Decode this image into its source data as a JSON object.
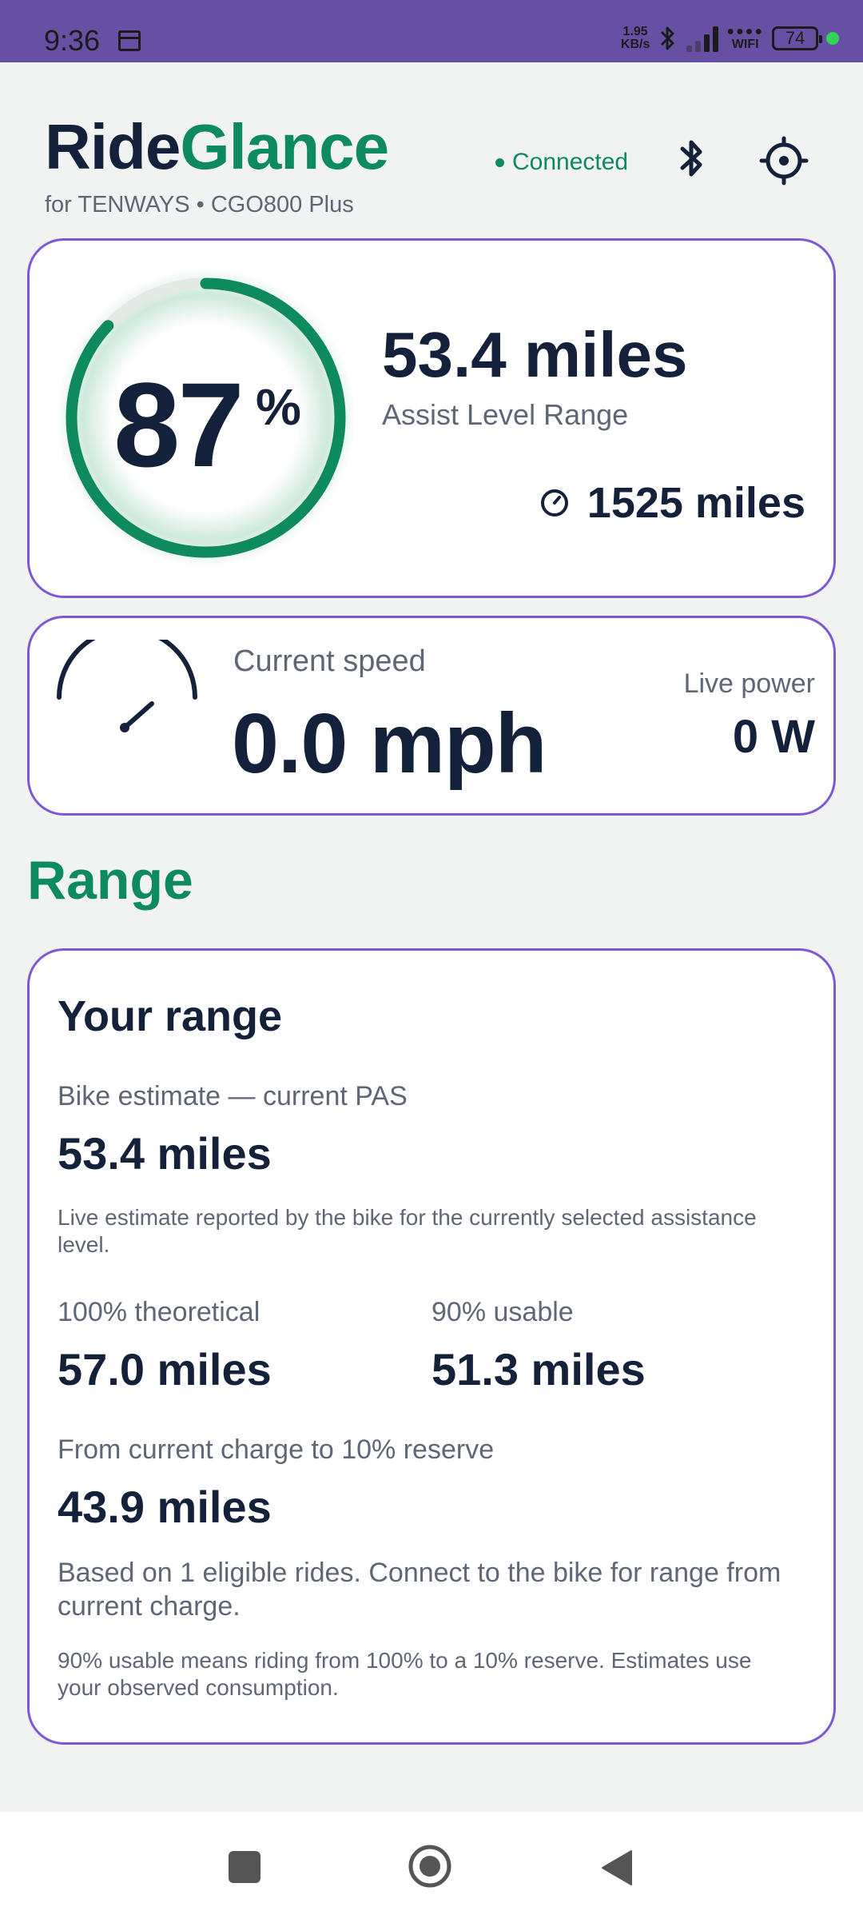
{
  "status_bar": {
    "time": "9:36",
    "net_speed_top": "1.95",
    "net_speed_bottom": "KB/s",
    "wifi_label": "WIFI",
    "battery": "74"
  },
  "header": {
    "title_part1": "Ride",
    "title_part2": "Glance",
    "subtitle": "for TENWAYS • CGO800 Plus",
    "connection_status": "Connected"
  },
  "battery_card": {
    "percent": "87",
    "percent_symbol": "%",
    "percent_fraction": 0.87,
    "range_value": "53.4 miles",
    "range_label": "Assist Level Range",
    "odometer": "1525 miles"
  },
  "speed_card": {
    "speed_label": "Current speed",
    "speed_value": "0.0 mph",
    "power_label": "Live power",
    "power_value": "0 W"
  },
  "range_section": {
    "title": "Range",
    "card_title": "Your range",
    "bike_estimate_label": "Bike estimate — current PAS",
    "bike_estimate_value": "53.4 miles",
    "bike_estimate_note": "Live estimate reported by the bike for the currently selected assistance level.",
    "theoretical_label": "100% theoretical",
    "theoretical_value": "57.0 miles",
    "usable_label": "90% usable",
    "usable_value": "51.3 miles",
    "reserve_label": "From current charge to 10% reserve",
    "reserve_value": "43.9 miles",
    "rides_note": "Based on 1 eligible rides. Connect to the bike for range from current charge.",
    "footer_note": "90% usable means riding from 100% to a 10% reserve. Estimates use your observed consumption."
  },
  "colors": {
    "accent_green": "#0e8a5f",
    "card_border": "#7e57d6",
    "status_bar": "#6750a4"
  }
}
